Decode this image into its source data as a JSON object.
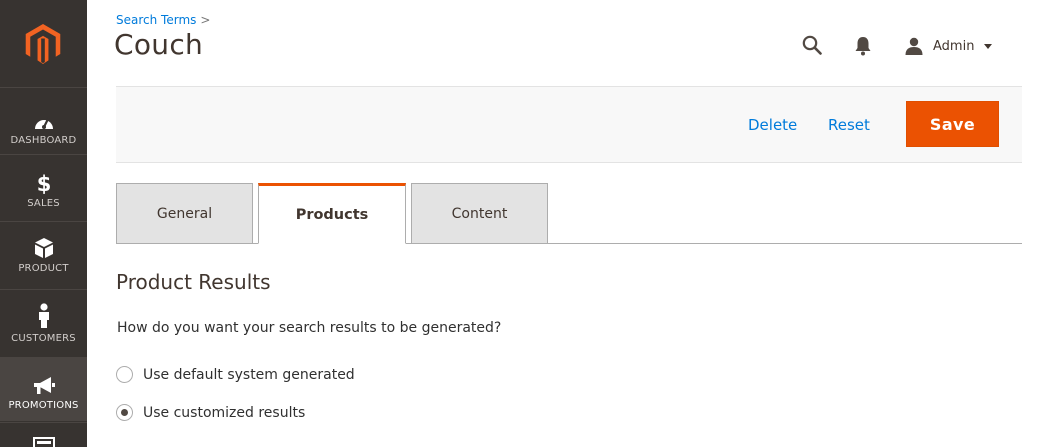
{
  "sidebar": {
    "logo": "magento-logo-icon",
    "items": [
      {
        "label": "DASHBOARD",
        "icon": "dashboard-gauge-icon"
      },
      {
        "label": "SALES",
        "icon": "dollar-icon"
      },
      {
        "label": "PRODUCT",
        "icon": "cube-icon"
      },
      {
        "label": "CUSTOMERS",
        "icon": "person-icon"
      },
      {
        "label": "PROMOTIONS",
        "icon": "megaphone-icon",
        "active": true
      },
      {
        "label": "",
        "icon": "content-icon"
      }
    ]
  },
  "header": {
    "breadcrumb": "Search Terms",
    "breadcrumb_sep": ">",
    "title": "Couch",
    "user_name": "Admin"
  },
  "actions": {
    "delete_label": "Delete",
    "reset_label": "Reset",
    "save_label": "Save"
  },
  "tabs": [
    {
      "label": "General"
    },
    {
      "label": "Products",
      "active": true
    },
    {
      "label": "Content"
    }
  ],
  "section": {
    "title": "Product Results",
    "question": "How do you want your search results to be generated?",
    "options": [
      {
        "label": "Use default system generated",
        "checked": false
      },
      {
        "label": "Use customized results",
        "checked": true
      }
    ]
  },
  "colors": {
    "accent": "#eb5202",
    "link": "#007bdb",
    "sidebar_bg": "#373330"
  }
}
